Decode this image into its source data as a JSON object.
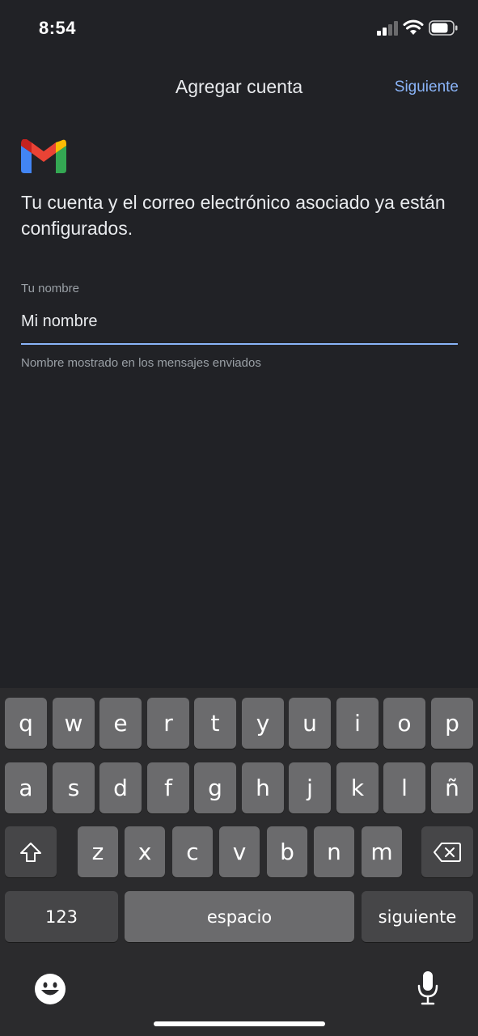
{
  "status_bar": {
    "time": "8:54",
    "signal_icon": "signal-bars-icon",
    "wifi_icon": "wifi-icon",
    "battery_icon": "battery-icon",
    "battery_level": 0.75
  },
  "nav": {
    "title": "Agregar cuenta",
    "next_label": "Siguiente"
  },
  "logo_icon": "gmail-logo-icon",
  "headline": "Tu cuenta y el correo electrónico asociado ya están configurados.",
  "name_field": {
    "label": "Tu nombre",
    "value": "Mi nombre",
    "helper": "Nombre mostrado en los mensajes enviados"
  },
  "keyboard": {
    "row1": [
      "q",
      "w",
      "e",
      "r",
      "t",
      "y",
      "u",
      "i",
      "o",
      "p"
    ],
    "row2": [
      "a",
      "s",
      "d",
      "f",
      "g",
      "h",
      "j",
      "k",
      "l",
      "ñ"
    ],
    "row3": [
      "z",
      "x",
      "c",
      "v",
      "b",
      "n",
      "m"
    ],
    "numbers_label": "123",
    "space_label": "espacio",
    "return_label": "siguiente",
    "shift_icon": "shift-icon",
    "delete_icon": "backspace-icon",
    "emoji_icon": "emoji-icon",
    "mic_icon": "microphone-icon"
  },
  "colors": {
    "background": "#212226",
    "accent": "#8ab4f8",
    "keyboard_bg": "#2b2b2d",
    "key": "#6b6b6d",
    "key_dark": "#464648"
  }
}
